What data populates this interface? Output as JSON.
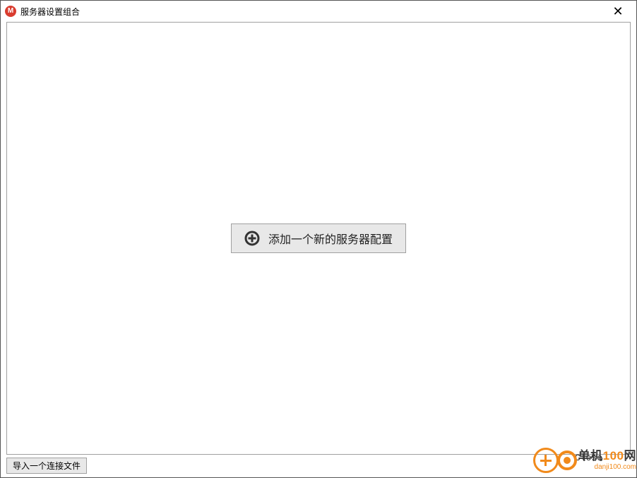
{
  "window": {
    "title": "服务器设置组合"
  },
  "main": {
    "add_server_label": "添加一个新的服务器配置"
  },
  "footer": {
    "import_label": "导入一个连接文件"
  },
  "watermark": {
    "close_text": "Close",
    "brand_cn_prefix": "单机",
    "brand_number": "100",
    "brand_cn_suffix": "网",
    "domain": "danji100.com"
  }
}
